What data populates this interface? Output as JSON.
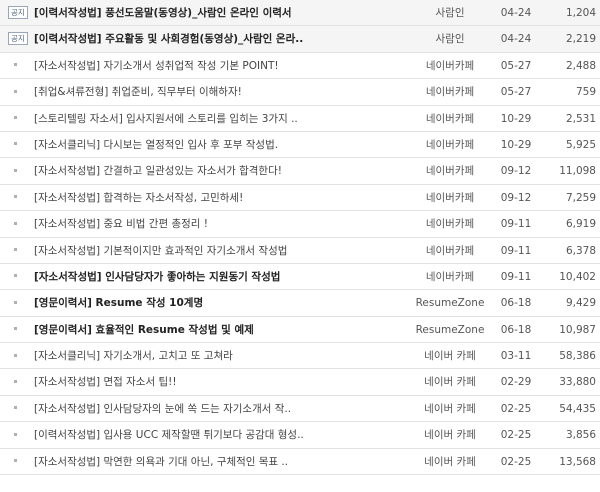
{
  "board": {
    "rows": [
      {
        "notice": true,
        "bold": true,
        "badge": "공지",
        "title": "[이력서작성법] 풍선도움말(동영상)_사람인 온라인 이력서",
        "source": "사람인",
        "date": "04-24",
        "views": "1,204"
      },
      {
        "notice": true,
        "bold": true,
        "badge": "공지",
        "title": "[이력서작성법] 주요활동 및 사회경험(동영상)_사람인 온라..",
        "source": "사람인",
        "date": "04-24",
        "views": "2,219"
      },
      {
        "notice": false,
        "bold": false,
        "badge": "",
        "title": "[자소서작성법] 자기소개서 성취업적 작성 기본 POINT!",
        "source": "네이버카페",
        "date": "05-27",
        "views": "2,488"
      },
      {
        "notice": false,
        "bold": false,
        "badge": "",
        "title": "[취업&셔류전형] 취업준비, 직무부터 이해하자!",
        "source": "네이버카페",
        "date": "05-27",
        "views": "759"
      },
      {
        "notice": false,
        "bold": false,
        "badge": "",
        "title": "[스토리텔링 자소서] 입사지원서에 스토리를 입히는 3가지 ..",
        "source": "네이버카페",
        "date": "10-29",
        "views": "2,531"
      },
      {
        "notice": false,
        "bold": false,
        "badge": "",
        "title": "[자소서클리닉] 다시보는 열정적인 입사 후 포부 작성법.",
        "source": "네이버카페",
        "date": "10-29",
        "views": "5,925"
      },
      {
        "notice": false,
        "bold": false,
        "badge": "",
        "title": "[자소서작성법] 간결하고 일관성있는 자소서가 합격한다!",
        "source": "네이버카페",
        "date": "09-12",
        "views": "11,098"
      },
      {
        "notice": false,
        "bold": false,
        "badge": "",
        "title": "[자소서작성법] 합격하는 자소서작성, 고민하세!",
        "source": "네이버카페",
        "date": "09-12",
        "views": "7,259"
      },
      {
        "notice": false,
        "bold": false,
        "badge": "",
        "title": "[자소서작성법] 중요 비법 간편 총정리 !",
        "source": "네이버카페",
        "date": "09-11",
        "views": "6,919"
      },
      {
        "notice": false,
        "bold": false,
        "badge": "",
        "title": "[자소서작성법] 기본적이지만 효과적인 자기소개서 작성법",
        "source": "네이버카페",
        "date": "09-11",
        "views": "6,378"
      },
      {
        "notice": false,
        "bold": true,
        "badge": "",
        "title": "[자소서작성법] 인사담당자가 좋아하는 지원동기 작성법",
        "source": "네이버카페",
        "date": "09-11",
        "views": "10,402"
      },
      {
        "notice": false,
        "bold": true,
        "badge": "",
        "title": "[영문이력서] Resume 작성 10계명",
        "source": "ResumeZone",
        "date": "06-18",
        "views": "9,429"
      },
      {
        "notice": false,
        "bold": true,
        "badge": "",
        "title": "[영문이력서] 효율적인 Resume 작성법 및 예제",
        "source": "ResumeZone",
        "date": "06-18",
        "views": "10,987"
      },
      {
        "notice": false,
        "bold": false,
        "badge": "",
        "title": "[자소서클리닉] 자기소개서, 고치고 또 고쳐라",
        "source": "네이버 카페",
        "date": "03-11",
        "views": "58,386"
      },
      {
        "notice": false,
        "bold": false,
        "badge": "",
        "title": "[자소서작성법] 면접 자소서 팁!!",
        "source": "네이버 카페",
        "date": "02-29",
        "views": "33,880"
      },
      {
        "notice": false,
        "bold": false,
        "badge": "",
        "title": "[자소서작성법] 인사담당자의 눈에 쏙 드는 자기소개서 작..",
        "source": "네이버 카페",
        "date": "02-25",
        "views": "54,435"
      },
      {
        "notice": false,
        "bold": false,
        "badge": "",
        "title": "[이력서작성법] 입사용 UCC 제작할땐 튀기보다 공감대 형성..",
        "source": "네이버 카페",
        "date": "02-25",
        "views": "3,856"
      },
      {
        "notice": false,
        "bold": false,
        "badge": "",
        "title": "[자소서작성법] 막연한 의욕과 기대 아닌, 구체적인 목표 ..",
        "source": "네이버 카페",
        "date": "02-25",
        "views": "13,568"
      }
    ]
  }
}
